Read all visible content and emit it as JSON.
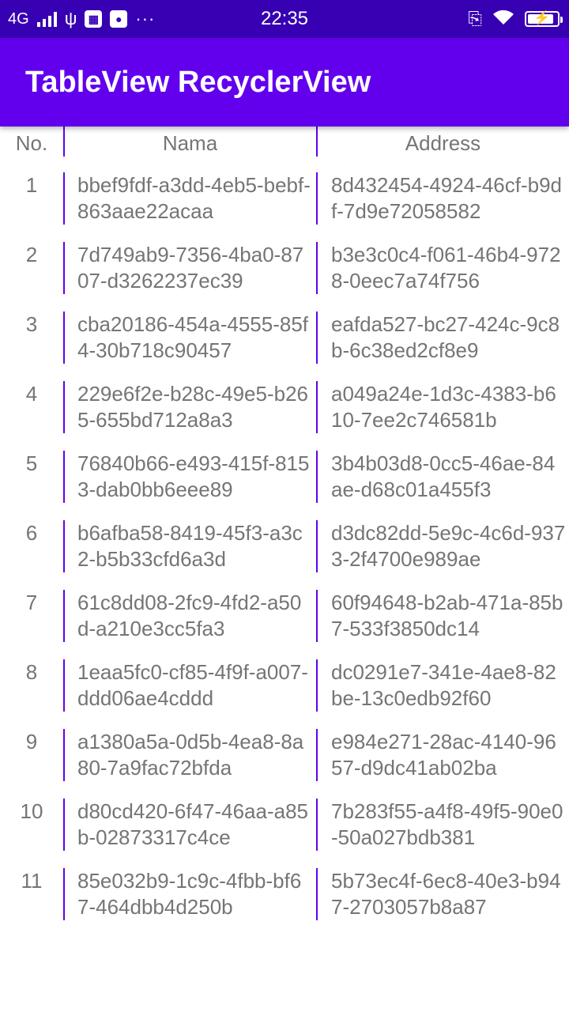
{
  "status_bar": {
    "network": "4G",
    "time": "22:35",
    "icons": [
      "signal-icon",
      "usb-icon",
      "notification-icon",
      "mic-icon",
      "more-icon",
      "vibrate-icon",
      "wifi-icon",
      "battery-icon"
    ],
    "battery_level": 0.9
  },
  "app_bar": {
    "title": "TableView RecyclerView"
  },
  "colors": {
    "primary": "#6200ee",
    "primary_dark": "#3700b3",
    "text": "#757575",
    "background": "#ffffff"
  },
  "table": {
    "headers": {
      "no": "No.",
      "nama": "Nama",
      "address": "Address"
    },
    "rows": [
      {
        "no": "1",
        "nama": "bbef9fdf-a3dd-4eb5-bebf-863aae22acaa",
        "address": "8d432454-4924-46cf-b9df-7d9e72058582"
      },
      {
        "no": "2",
        "nama": "7d749ab9-7356-4ba0-8707-d3262237ec39",
        "address": "b3e3c0c4-f061-46b4-9728-0eec7a74f756"
      },
      {
        "no": "3",
        "nama": "cba20186-454a-4555-85f4-30b718c90457",
        "address": "eafda527-bc27-424c-9c8b-6c38ed2cf8e9"
      },
      {
        "no": "4",
        "nama": "229e6f2e-b28c-49e5-b265-655bd712a8a3",
        "address": "a049a24e-1d3c-4383-b610-7ee2c746581b"
      },
      {
        "no": "5",
        "nama": "76840b66-e493-415f-8153-dab0bb6eee89",
        "address": "3b4b03d8-0cc5-46ae-84ae-d68c01a455f3"
      },
      {
        "no": "6",
        "nama": "b6afba58-8419-45f3-a3c2-b5b33cfd6a3d",
        "address": "d3dc82dd-5e9c-4c6d-9373-2f4700e989ae"
      },
      {
        "no": "7",
        "nama": "61c8dd08-2fc9-4fd2-a50d-a210e3cc5fa3",
        "address": "60f94648-b2ab-471a-85b7-533f3850dc14"
      },
      {
        "no": "8",
        "nama": "1eaa5fc0-cf85-4f9f-a007-ddd06ae4cddd",
        "address": "dc0291e7-341e-4ae8-82be-13c0edb92f60"
      },
      {
        "no": "9",
        "nama": "a1380a5a-0d5b-4ea8-8a80-7a9fac72bfda",
        "address": "e984e271-28ac-4140-9657-d9dc41ab02ba"
      },
      {
        "no": "10",
        "nama": "d80cd420-6f47-46aa-a85b-02873317c4ce",
        "address": "7b283f55-a4f8-49f5-90e0-50a027bdb381"
      },
      {
        "no": "11",
        "nama": "85e032b9-1c9c-4fbb-bf67-464dbb4d250b",
        "address": "5b73ec4f-6ec8-40e3-b947-2703057b8a87"
      }
    ]
  }
}
